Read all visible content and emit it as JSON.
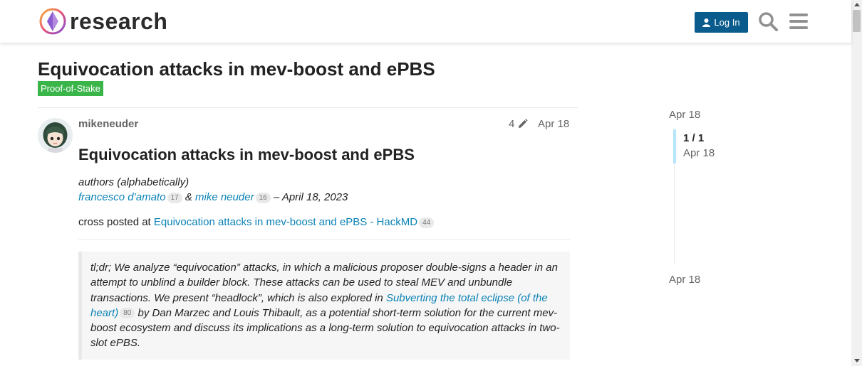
{
  "header": {
    "logo_text": "research",
    "login_label": "Log In"
  },
  "topic": {
    "title": "Equivocation attacks in mev-boost and ePBS",
    "category": "Proof-of-Stake",
    "category_color": "#3ab54a"
  },
  "post": {
    "username": "mikeneuder",
    "edit_count": "4",
    "date": "Apr 18",
    "heading": "Equivocation attacks in mev-boost and ePBS",
    "authors_line": "authors (alphabetically)",
    "author1": "francesco d’amato",
    "author1_count": "17",
    "amp": " & ",
    "author2": "mike neuder",
    "author2_count": "16",
    "author_date": " – April 18, 2023",
    "cross_prefix": "cross posted at ",
    "cross_link": "Equivocation attacks in mev-boost and ePBS - HackMD",
    "cross_count": "44",
    "quote_part1": "tl;dr; We analyze “equivocation” attacks, in which a malicious proposer double-signs a header in an attempt to unblind a builder block. These attacks can be used to steal MEV and unbundle transactions. We present “headlock”, which is also explored in ",
    "quote_link": "Subverting the total eclipse (of the heart)",
    "quote_link_count": "80",
    "quote_part2": " by Dan Marzec and Louis Thibault, as a potential short-term solution for the current mev-boost ecosystem and discuss its implications as a long-term solution to equivocation attacks in two-slot ePBS."
  },
  "timeline": {
    "top_date": "Apr 18",
    "position": "1 / 1",
    "position_date": "Apr 18",
    "bottom_date": "Apr 18"
  },
  "colors": {
    "accent": "#0a5c8d",
    "link": "#0a82b5"
  }
}
